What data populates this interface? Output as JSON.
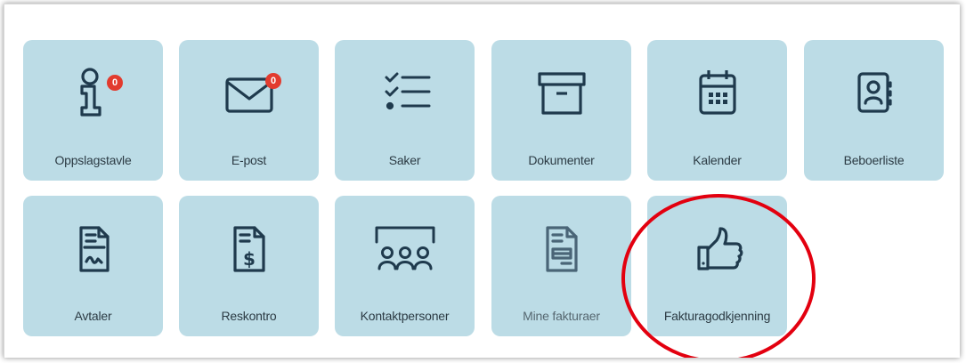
{
  "tiles": [
    {
      "label": "Oppslagstavle",
      "icon": "info-icon",
      "badge": "0"
    },
    {
      "label": "E-post",
      "icon": "envelope-icon",
      "badge": "0"
    },
    {
      "label": "Saker",
      "icon": "checklist-icon"
    },
    {
      "label": "Dokumenter",
      "icon": "archive-box-icon"
    },
    {
      "label": "Kalender",
      "icon": "calendar-icon"
    },
    {
      "label": "Beboerliste",
      "icon": "address-book-icon"
    },
    {
      "label": "Avtaler",
      "icon": "signed-document-icon"
    },
    {
      "label": "Reskontro",
      "icon": "dollar-document-icon"
    },
    {
      "label": "Kontaktpersoner",
      "icon": "group-people-icon"
    },
    {
      "label": "Mine fakturaer",
      "icon": "invoice-document-icon"
    },
    {
      "label": "Fakturagodkjenning",
      "icon": "thumbs-up-icon"
    }
  ],
  "colors": {
    "tile_background": "#bcdce6",
    "icon_color": "#1f3a4d",
    "badge_color": "#e23b2e",
    "highlight_circle": "#e3000f"
  }
}
